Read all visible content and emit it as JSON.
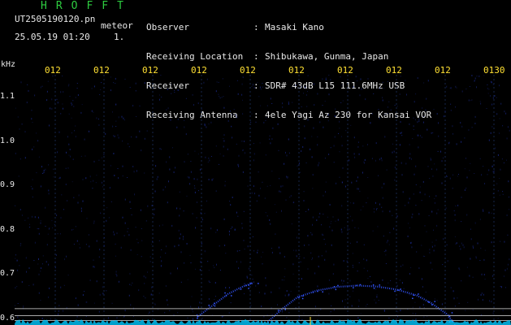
{
  "header": {
    "app_title": "HROFFT",
    "filename": "UT2505190120.pn",
    "meteor_label": "meteor",
    "datetime": "25.05.19 01:20",
    "count": "1.",
    "info": [
      {
        "key": "Observer",
        "value": "Masaki Kano"
      },
      {
        "key": "Receiving Location",
        "value": "Shibukawa, Gunma, Japan"
      },
      {
        "key": "Receiver",
        "value": "SDR# 43dB L15 111.6MHz USB"
      },
      {
        "key": "Receiving Antenna",
        "value": "4ele Yagi Az 230 for Kansai VOR"
      }
    ]
  },
  "chart_data": {
    "type": "heatmap",
    "ylabel": "kHz",
    "x_ticks": [
      "012",
      "012",
      "012",
      "012",
      "012",
      "012",
      "012",
      "012",
      "012",
      "0130"
    ],
    "y_ticks": [
      "1.1",
      "1.0",
      "0.9",
      "0.8",
      "0.7",
      "0.6"
    ],
    "ylim": [
      0.585,
      1.15
    ],
    "reference_lines_khz": [
      0.622,
      0.606,
      0.595
    ],
    "echo_trace": [
      {
        "t": 0.37,
        "f": 0.605
      },
      {
        "t": 0.4,
        "f": 0.63
      },
      {
        "t": 0.43,
        "f": 0.655
      },
      {
        "t": 0.46,
        "f": 0.672
      },
      {
        "t": 0.48,
        "f": 0.68
      }
    ],
    "main_echo_trace": [
      {
        "t": 0.51,
        "f": 0.592
      },
      {
        "t": 0.54,
        "f": 0.622
      },
      {
        "t": 0.57,
        "f": 0.648
      },
      {
        "t": 0.61,
        "f": 0.663
      },
      {
        "t": 0.65,
        "f": 0.671
      },
      {
        "t": 0.69,
        "f": 0.674
      },
      {
        "t": 0.73,
        "f": 0.672
      },
      {
        "t": 0.77,
        "f": 0.665
      },
      {
        "t": 0.81,
        "f": 0.652
      },
      {
        "t": 0.84,
        "f": 0.634
      },
      {
        "t": 0.87,
        "f": 0.61
      },
      {
        "t": 0.885,
        "f": 0.59
      }
    ],
    "colors": {
      "background": "#000000",
      "noise": "#1a2a8a",
      "echo": "#3355ff",
      "grid": "#16264a",
      "reference_line": "#a8a8a8",
      "baseline": "#00c8ff",
      "tick_label": "#ffe033"
    }
  }
}
